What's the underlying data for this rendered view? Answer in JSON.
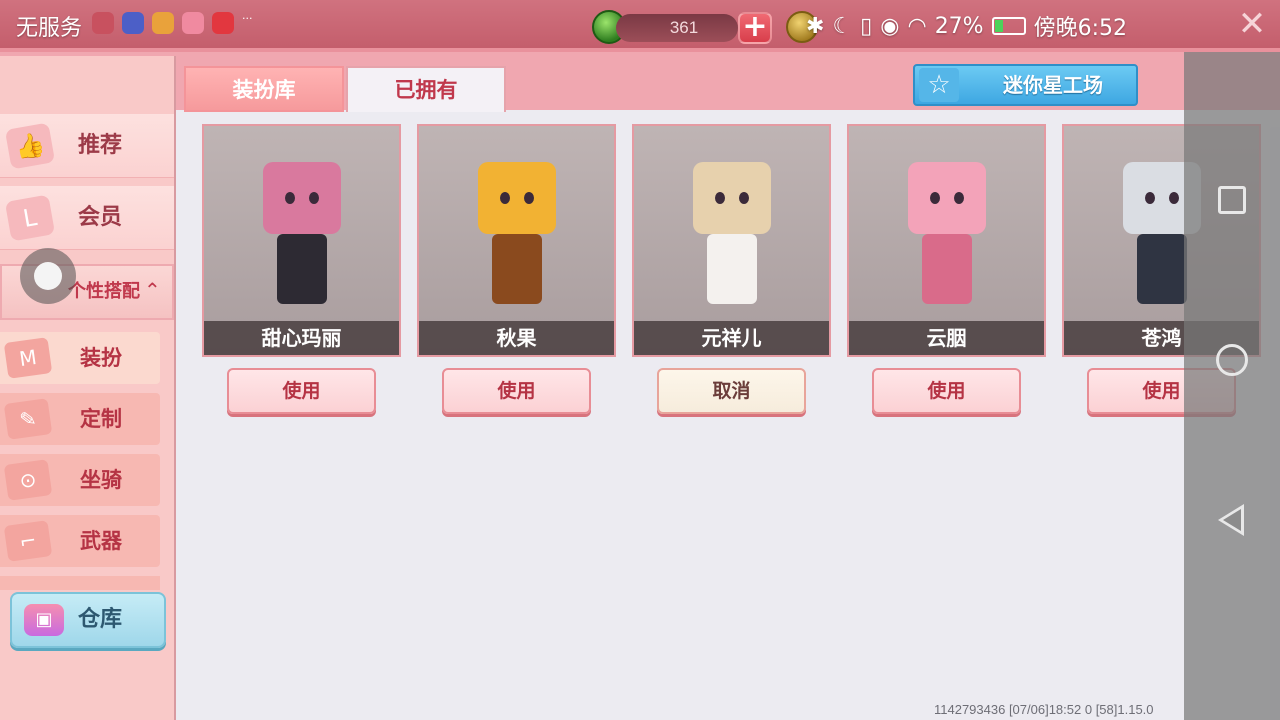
{
  "status_bar": {
    "carrier": "无服务",
    "battery_percent": "27%",
    "time": "傍晚6:52"
  },
  "currency": {
    "gems": "361"
  },
  "sidebar": {
    "items": [
      {
        "label": "推荐",
        "icon": "thumbs-up-icon"
      },
      {
        "label": "会员",
        "icon": "vip-card-icon"
      },
      {
        "label": "个性搭配",
        "icon": "chevron-up-icon",
        "expanded": true
      }
    ],
    "sub_items": [
      {
        "label": "装扮",
        "icon": "shirt-icon",
        "active": true
      },
      {
        "label": "定制",
        "icon": "pencil-ruler-icon"
      },
      {
        "label": "坐骑",
        "icon": "stroller-icon"
      },
      {
        "label": "武器",
        "icon": "gun-icon"
      }
    ],
    "warehouse_label": "仓库"
  },
  "tabs": [
    {
      "label": "装扮库",
      "active": false
    },
    {
      "label": "已拥有",
      "active": true
    }
  ],
  "workshop_label": "迷你星工场",
  "cards": [
    {
      "name": "甜心玛丽",
      "button": "使用",
      "hair": "#d9799e",
      "outfit": "#2d2a33"
    },
    {
      "name": "秋果",
      "button": "使用",
      "hair": "#f2b233",
      "outfit": "#8a4a1e"
    },
    {
      "name": "元祥儿",
      "button": "取消",
      "hair": "#e7d1ad",
      "outfit": "#f4f1ee"
    },
    {
      "name": "云胭",
      "button": "使用",
      "hair": "#f3a3b9",
      "outfit": "#d96b8a"
    },
    {
      "name": "苍鸿",
      "button": "使用",
      "hair": "#dadde3",
      "outfit": "#2f3442"
    }
  ],
  "footer": "1142793436    [07/06]18:52 0    [58]1.15.0",
  "colors": {
    "accent_pink": "#c0384c",
    "workshop_blue": "#3ea7e2",
    "panel_bg": "#ecebf1"
  }
}
